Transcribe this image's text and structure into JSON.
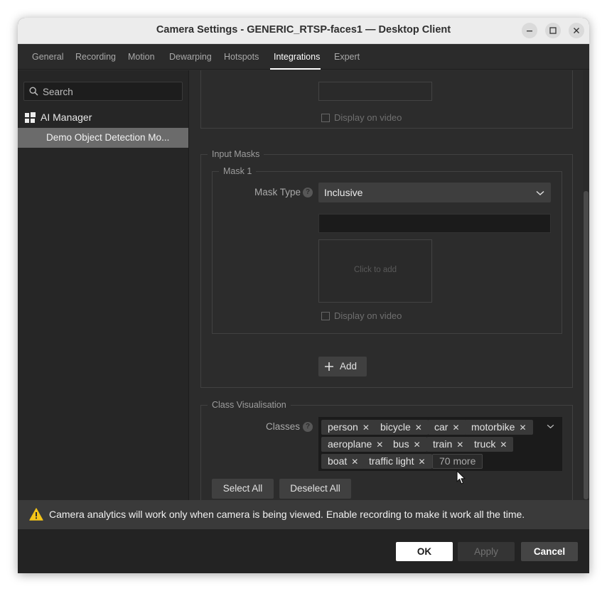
{
  "window": {
    "title": "Camera Settings - GENERIC_RTSP-faces1 — Desktop Client",
    "controls": [
      "minimize-icon",
      "maximize-icon",
      "close-icon"
    ]
  },
  "tabs": [
    {
      "label": "General"
    },
    {
      "label": "Recording"
    },
    {
      "label": "Motion"
    },
    {
      "label": "Dewarping"
    },
    {
      "label": "Hotspots"
    },
    {
      "label": "Integrations",
      "active": true
    },
    {
      "label": "Expert"
    }
  ],
  "sidebar": {
    "search_placeholder": "Search",
    "tree_root": "AI Manager",
    "tree_child": "Demo Object Detection Mo..."
  },
  "content": {
    "top_roi": {
      "display_on_video": "Display on video"
    },
    "input_masks": {
      "legend": "Input Masks",
      "mask": {
        "legend": "Mask 1",
        "type_label": "Mask Type",
        "type_value": "Inclusive",
        "name_value": "",
        "area_placeholder": "Click to add",
        "display_on_video": "Display on video"
      },
      "add_label": "Add"
    },
    "class_visualisation": {
      "legend": "Class Visualisation",
      "classes_label": "Classes",
      "chips": [
        "person",
        "bicycle",
        "car",
        "motorbike",
        "aeroplane",
        "bus",
        "train",
        "truck",
        "boat",
        "traffic light"
      ],
      "more_label": "70 more",
      "select_all": "Select All",
      "deselect_all": "Deselect All"
    }
  },
  "notice": {
    "icon": "warning-icon",
    "text": "Camera analytics will work only when camera is being viewed. Enable recording to make it work all the time."
  },
  "footer": {
    "ok": "OK",
    "apply": "Apply",
    "cancel": "Cancel"
  },
  "colors": {
    "accent": "#ffffff",
    "background": "#2c2c2c",
    "selected_item": "#6b6b6b",
    "warning": "#f5c518"
  }
}
